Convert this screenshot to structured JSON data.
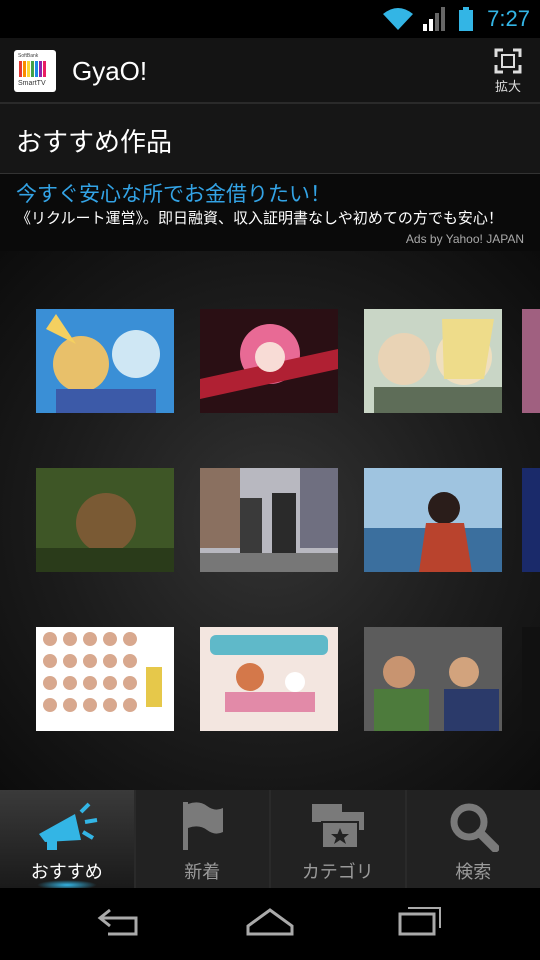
{
  "status": {
    "time": "7:27"
  },
  "app": {
    "title": "GyaO!",
    "logo_top": "SoftBank",
    "logo_bottom": "SmartTV",
    "zoom_label": "拡大"
  },
  "section": {
    "title": "おすすめ作品"
  },
  "ad": {
    "title": "今すぐ安心な所でお金借りたい！",
    "body": "《リクルート運営》。即日融資、収入証明書なしや初めての方でも安心！",
    "credit": "Ads by Yahoo! JAPAN"
  },
  "thumbnails": [
    "anime-characters-blue-sky",
    "anime-girl-pink-hair",
    "anime-two-characters-green",
    "jungle-explorer",
    "men-on-city-street",
    "woman-by-the-sea",
    "idol-group-collage",
    "girls-at-cafe-table",
    "two-men-talking"
  ],
  "tabs": [
    {
      "label": "おすすめ",
      "icon": "megaphone-icon",
      "active": true
    },
    {
      "label": "新着",
      "icon": "flag-icon",
      "active": false
    },
    {
      "label": "カテゴリ",
      "icon": "category-folders-icon",
      "active": false
    },
    {
      "label": "検索",
      "icon": "search-icon",
      "active": false
    }
  ],
  "colors": {
    "accent": "#33b5e5",
    "ad_title": "#33a3e5",
    "logo_bars": [
      "#e53935",
      "#fb8c00",
      "#fdd835",
      "#43a047",
      "#1e88e5",
      "#8e24aa",
      "#e91e63"
    ]
  }
}
